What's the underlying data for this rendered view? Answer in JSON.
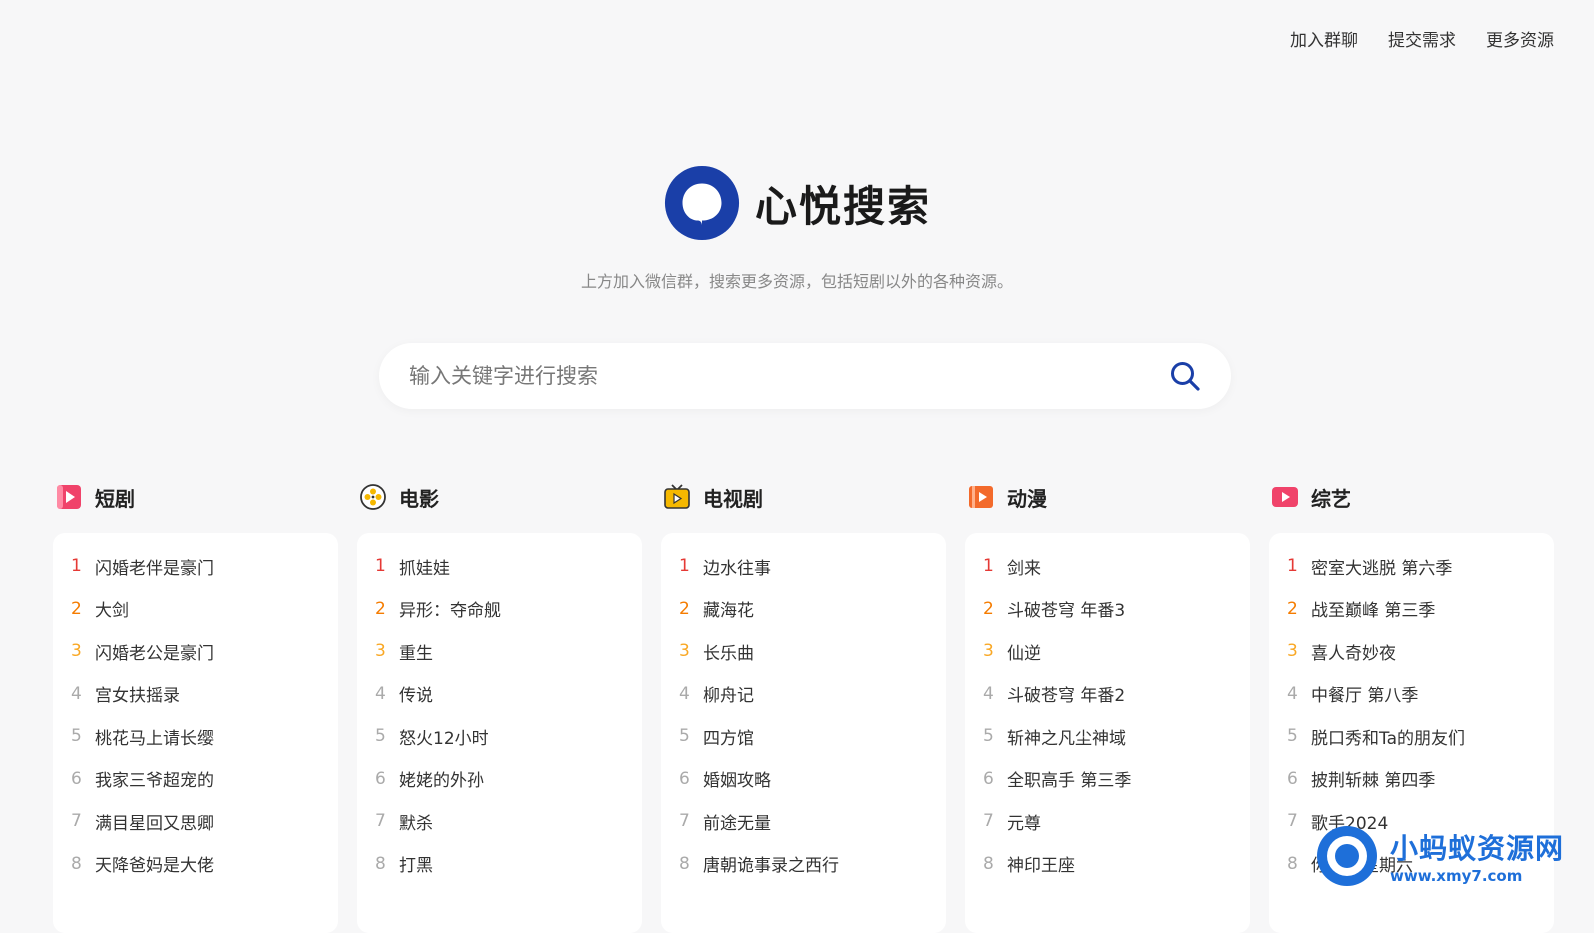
{
  "topnav": [
    "加入群聊",
    "提交需求",
    "更多资源"
  ],
  "brand": {
    "name": "心悦搜索",
    "color": "#1a3fa8"
  },
  "subtitle": "上方加入微信群，搜索更多资源，包括短剧以外的各种资源。",
  "search": {
    "placeholder": "输入关键字进行搜索",
    "icon": "search-icon"
  },
  "categories": [
    {
      "title": "短剧",
      "icon": "play-square-icon",
      "color": "#f0436a",
      "items": [
        "闪婚老伴是豪门",
        "大剑",
        "闪婚老公是豪门",
        "宫女扶摇录",
        "桃花马上请长缨",
        "我家三爷超宠的",
        "满目星回又思卿",
        "天降爸妈是大佬"
      ]
    },
    {
      "title": "电影",
      "icon": "film-reel-icon",
      "color": "#f5b800",
      "items": [
        "抓娃娃",
        "异形：夺命舰",
        "重生",
        "传说",
        "怒火12小时",
        "姥姥的外孙",
        "默杀",
        "打黑"
      ]
    },
    {
      "title": "电视剧",
      "icon": "tv-icon",
      "color": "#f5b800",
      "items": [
        "边水往事",
        "藏海花",
        "长乐曲",
        "柳舟记",
        "四方馆",
        "婚姻攻略",
        "前途无量",
        "唐朝诡事录之西行"
      ]
    },
    {
      "title": "动漫",
      "icon": "play-box-icon",
      "color": "#f36a2b",
      "items": [
        "剑来",
        "斗破苍穹 年番3",
        "仙逆",
        "斗破苍穹 年番2",
        "斩神之凡尘神域",
        "全职高手 第三季",
        "元尊",
        "神印王座"
      ]
    },
    {
      "title": "综艺",
      "icon": "play-rect-icon",
      "color": "#f0436a",
      "items": [
        "密室大逃脱 第六季",
        "战至巅峰 第三季",
        "喜人奇妙夜",
        "中餐厅 第八季",
        "脱口秀和Ta的朋友们",
        "披荆斩棘 第四季",
        "歌手2024",
        "你好，星期六"
      ]
    }
  ],
  "watermark": {
    "title": "小蚂蚁资源网",
    "url": "www.xmy7.com"
  }
}
